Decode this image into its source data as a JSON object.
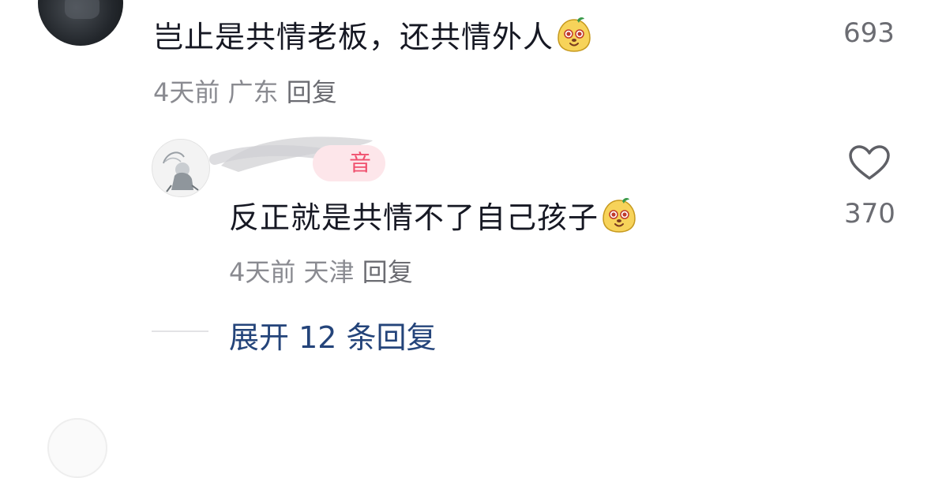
{
  "comment1": {
    "text": "岂止是共情老板，还共情外人",
    "emoji": "mango-smile-emoji",
    "time": "4天前",
    "location": "广东",
    "reply_label": "回复",
    "like_count": "693"
  },
  "reply1": {
    "badge": "音",
    "text": "反正就是共情不了自己孩子",
    "emoji": "mango-smile-emoji",
    "time": "4天前",
    "location": "天津",
    "reply_label": "回复",
    "like_icon": "heart-outline-icon",
    "like_count": "370"
  },
  "expand": {
    "label": "展开 12 条回复"
  },
  "colors": {
    "text_primary": "#161823",
    "text_meta": "#8a8b91",
    "link": "#24447a",
    "badge_bg": "#fde6ea",
    "badge_text": "#f0506e"
  }
}
